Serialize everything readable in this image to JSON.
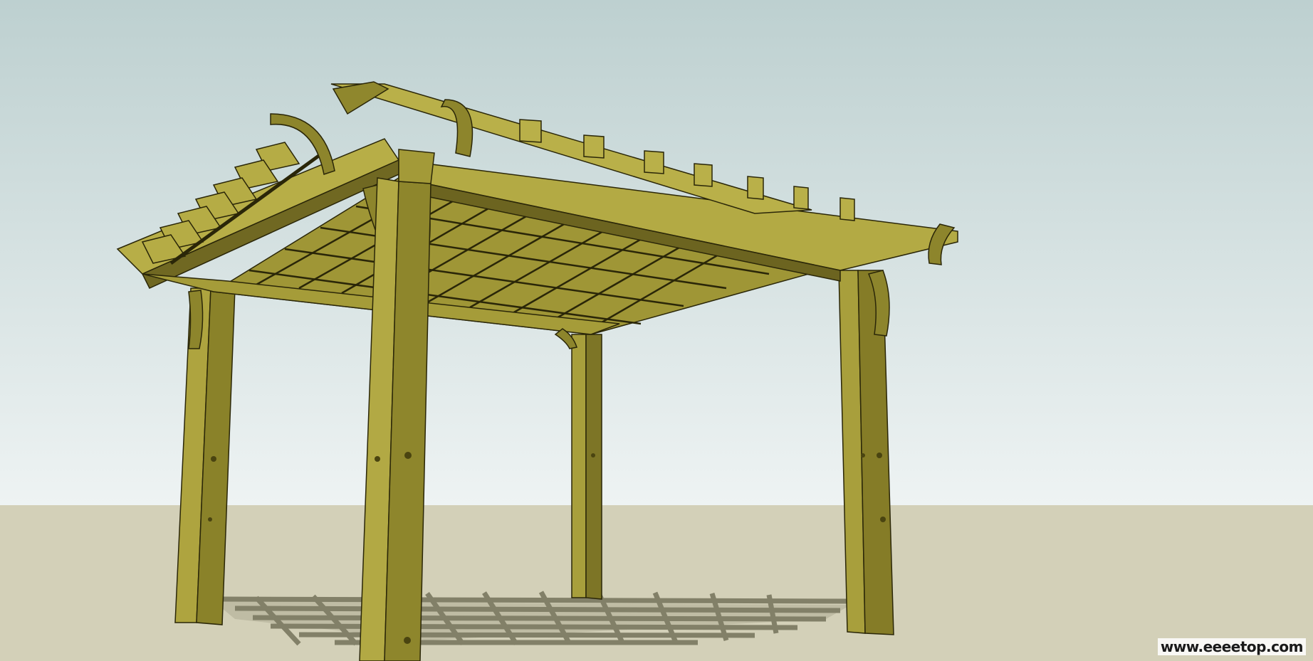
{
  "scene": {
    "subject": "pergola",
    "colors": {
      "sky_top": "#bdd0d0",
      "sky_bottom": "#eef3f3",
      "ground": "#d3d0b8",
      "wood_light": "#b5ac45",
      "wood_mid": "#9c9334",
      "wood_dark": "#6c6420",
      "edge": "#2a2608",
      "shadow": "#7a7860"
    }
  },
  "watermark": {
    "text": "www.eeeetop.com"
  }
}
